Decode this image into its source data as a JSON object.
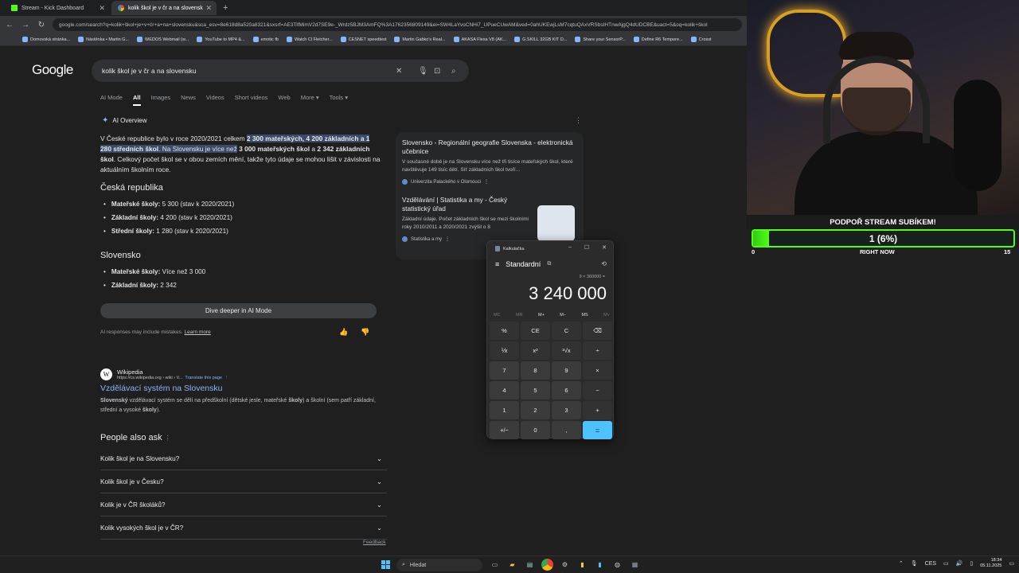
{
  "browser": {
    "tabs": [
      {
        "label": "Stream - Kick Dashboard"
      },
      {
        "label": "kolik škol je v čr a na slovensk"
      }
    ],
    "url": "google.com/search?q=kolik+škol+je+v+čr+a+na+slovensku&sca_esv=8e618d8a520a8321&sxsrf=AE3TifMimV2d7SE9e-_Wrdz5BJM3AmFQ%3A1762356809149&ei=SW4LaYvoCNHi7_UPueCUwAM&ved=0ahUKEwjLsM7cqtuQAxVRSbsIHTnwAjgQ4dUDCBE&uact=5&oq=kolik+škol",
    "bookmarks": [
      "Domovská stránka...",
      "Nástěnka • Martin G...",
      "WEDOS Webmail (w...",
      "YouTube to MP4 &...",
      "emotic fb",
      "Watch Cl Fletcher...",
      "CESNET speedtest",
      "Martin Gabko's Real...",
      "AKASA Flexa V8 (AK...",
      "G.SKILL 32GB KIT D...",
      "Share your SensorP...",
      "Define R6 Tempere...",
      "Crosst"
    ]
  },
  "google": {
    "logo": "Google",
    "query": "kolik škol je v čr a na slovensku",
    "tabs": [
      "AI Mode",
      "All",
      "Images",
      "News",
      "Videos",
      "Short videos",
      "Web",
      "More ▾",
      "Tools ▾"
    ],
    "ai_overview_label": "AI Overview",
    "intro": {
      "p1": "V České republice bylo v roce 2020/2021 celkem ",
      "hl1": "2 300 mateřských, 4 200 základních a 1 280 středních škol",
      "p2": ". Na Slovensku je více než",
      "p3": " 3 000 mateřských škol",
      "p4": " a ",
      "p5": "2 342 základních škol",
      "p6": ". Celkový počet škol se v obou zemích mění, takže tyto údaje se mohou lišit v závislosti na aktuálním školním roce."
    },
    "cz_heading": "Česká republika",
    "cz_items": [
      {
        "k": "Mateřské školy:",
        "v": " 5 300 (stav k 2020/2021)"
      },
      {
        "k": "Základní školy:",
        "v": " 4 200 (stav k 2020/2021)"
      },
      {
        "k": "Střední školy:",
        "v": " 1 280 (stav k 2020/2021)"
      }
    ],
    "sk_heading": "Slovensko",
    "sk_items": [
      {
        "k": "Mateřské školy:",
        "v": " Více než 3 000"
      },
      {
        "k": "Základní školy:",
        "v": " 2 342"
      }
    ],
    "dive_deeper": "Dive deeper in AI Mode",
    "ai_disclaimer": "AI responses may include mistakes.",
    "learn_more": "Learn more",
    "side_sources": [
      {
        "title": "Slovensko - Regionální geografie Slovenska - elektronická učebnice",
        "desc": "V současné době je na Slovensku více než tři tisíce mateřských škol, které navštěvuje 149 tisíc dětí. Síť základních škol tvoří...",
        "src": "Univerzita Palackého v Olomouci"
      },
      {
        "title": "Vzdělávání | Statistika a my - Český statistický úřad",
        "desc": "Základní údaje. Počet základních škol se mezi školními roky 2010/2011 a 2020/2021 zvýšil o 8",
        "src": "Statistika a my"
      }
    ],
    "wiki": {
      "name": "Wikipedia",
      "url": "https://cs.wikipedia.org › wiki › V...",
      "translate": "Translate this page",
      "title": "Vzdělávací systém na Slovensku",
      "desc_b1": "Slovenský",
      "desc_1": " vzdělávací systém se dělí na předškolní (dětské jesle, mateřské ",
      "desc_b2": "školy",
      "desc_2": ") a školní (sem patří základní, střední a vysoké ",
      "desc_b3": "školy",
      "desc_3": ")."
    },
    "paa_heading": "People also ask",
    "paa": [
      "Kolik škol je na Slovensku?",
      "Kolik škol je v Česku?",
      "Kolik je v ČR školáků?",
      "Kolik vysokých škol je v ČR?"
    ],
    "feedback": "Feedback"
  },
  "calculator": {
    "title": "Kalkulačka",
    "mode": "Standardní",
    "expression": "9 × 360000 =",
    "display": "3 240 000",
    "memory": [
      "MC",
      "MR",
      "M+",
      "M−",
      "MS",
      "M˅"
    ],
    "keys": [
      "%",
      "CE",
      "C",
      "⌫",
      "⅟x",
      "x²",
      "²√x",
      "÷",
      "7",
      "8",
      "9",
      "×",
      "4",
      "5",
      "6",
      "−",
      "1",
      "2",
      "3",
      "+",
      "+/−",
      "0",
      ",",
      "="
    ]
  },
  "overlay": {
    "title": "PODPOŘ STREAM SUBÍKEM!",
    "bar_text": "1 (6%)",
    "progress": 0.06,
    "left": "0",
    "mid": "RIGHT NOW",
    "right": "15",
    "bar_color": "#53fc18"
  },
  "taskbar": {
    "search": "Hledat",
    "lang": "CES",
    "time": "18:34",
    "date": "05.11.2025"
  }
}
